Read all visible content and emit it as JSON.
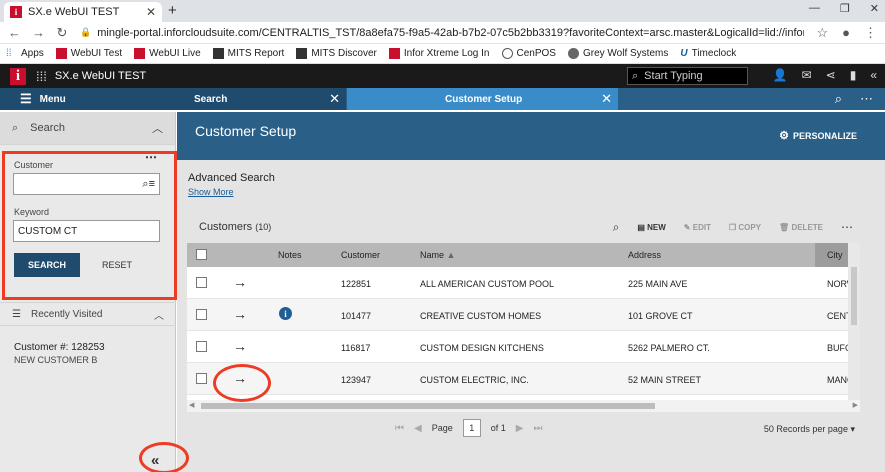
{
  "browser": {
    "tab_title": "SX.e WebUI TEST",
    "url": "mingle-portal.inforcloudsuite.com/CENTRALTIS_TST/8a8efa75-f9a5-42ab-b7b2-07c5b2bb3319?favoriteContext=arsc.master&LogicalId=lid://infor.sx.1",
    "bookmarks": [
      "Apps",
      "WebUI Test",
      "WebUI Live",
      "MITS Report",
      "MITS Discover",
      "Infor Xtreme Log In",
      "CenPOS",
      "Grey Wolf Systems",
      "Timeclock"
    ]
  },
  "app": {
    "title": "SX.e WebUI TEST",
    "search_placeholder": "Start Typing"
  },
  "modbar": {
    "menu_label": "Menu",
    "tabs": [
      {
        "label": "Search"
      },
      {
        "label": "Customer Setup"
      }
    ]
  },
  "left": {
    "search_label": "Search",
    "customer_label": "Customer",
    "customer_value": "",
    "keyword_label": "Keyword",
    "keyword_value": "CUSTOM CT",
    "search_button": "SEARCH",
    "reset_button": "RESET",
    "recent_label": "Recently Visited",
    "recent_title": "Customer #:  128253",
    "recent_sub": "NEW CUSTOMER B"
  },
  "main": {
    "title": "Customer Setup",
    "personalize": "PERSONALIZE",
    "advanced_search": "Advanced Search",
    "show_more": "Show More",
    "grid_title": "Customers",
    "grid_count": "(10)",
    "actions": {
      "new": "NEW",
      "edit": "EDIT",
      "copy": "COPY",
      "delete": "DELETE"
    },
    "columns": [
      "Notes",
      "Customer",
      "Name",
      "Address",
      "City"
    ],
    "rows": [
      {
        "customer": "122851",
        "name": "ALL AMERICAN CUSTOM POOL",
        "address": "225 MAIN AVE",
        "city": "NORWA",
        "note": false
      },
      {
        "customer": "101477",
        "name": "CREATIVE CUSTOM HOMES",
        "address": "101 GROVE CT",
        "city": "CENTE",
        "note": true
      },
      {
        "customer": "116817",
        "name": "CUSTOM DESIGN KITCHENS",
        "address": "5262 PALMERO CT.",
        "city": "BUFOR",
        "note": false
      },
      {
        "customer": "123947",
        "name": "CUSTOM ELECTRIC, INC.",
        "address": "52 MAIN STREET",
        "city": "MANCH",
        "note": false
      }
    ],
    "pager": {
      "page_label": "Page",
      "page": "1",
      "of_label": "of 1",
      "per_page": "50 Records per page"
    }
  }
}
